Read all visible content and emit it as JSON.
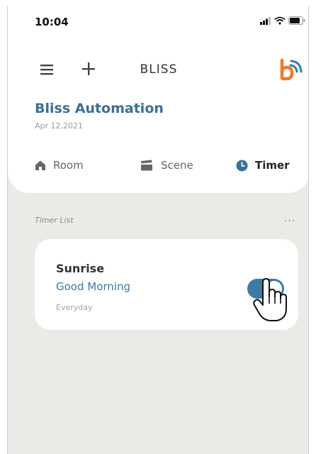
{
  "status_bar": {
    "time": "10:04",
    "icons": [
      "signal-icon",
      "wifi-icon",
      "battery-icon"
    ]
  },
  "header": {
    "title": "BLISS",
    "menu_icon": "hamburger-icon",
    "add_icon": "plus-icon",
    "logo_icon": "bliss-logo-icon"
  },
  "home": {
    "name": "Bliss Automation",
    "date": "Apr 12,2021"
  },
  "tabs": [
    {
      "label": "Room",
      "icon": "house-icon",
      "active": false
    },
    {
      "label": "Scene",
      "icon": "scene-icon",
      "active": false
    },
    {
      "label": "Timer",
      "icon": "clock-icon",
      "active": true
    }
  ],
  "timer_list": {
    "label": "Timer List",
    "more": "...",
    "items": [
      {
        "name": "Sunrise",
        "scene": "Good Morning",
        "repeat": "Everyday",
        "enabled": true
      }
    ]
  },
  "colors": {
    "accent": "#3a6f96",
    "toggle_on": "#3d7ba5",
    "background": "#eceae6",
    "logo_orange": "#f07a2a",
    "logo_blue": "#3a7aa6"
  }
}
